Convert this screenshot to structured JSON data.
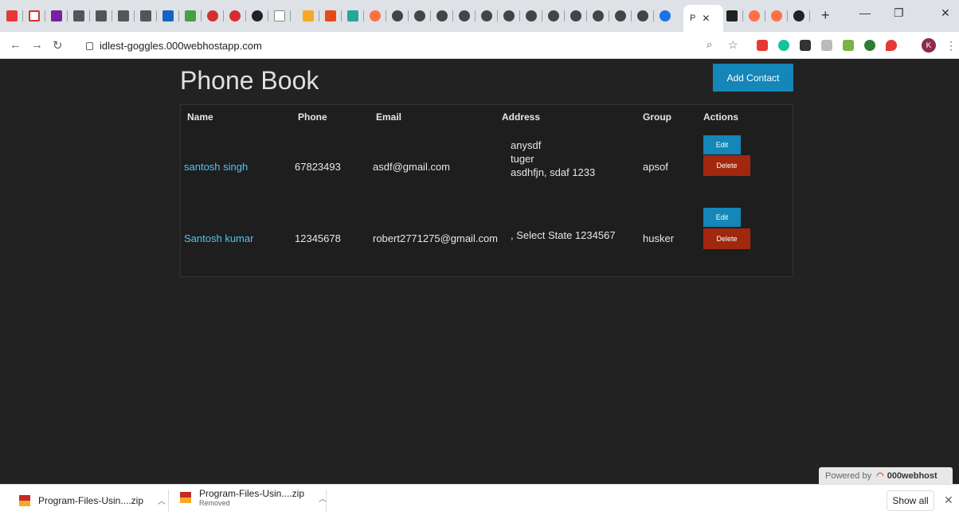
{
  "browser": {
    "active_tab_label": "P",
    "new_tab": "+",
    "url": "idlest-goggles.000webhostapp.com",
    "profile_initial": "K",
    "colors": {
      "tabstrip": "#dee1e6",
      "toolbar": "#ffffff"
    }
  },
  "page": {
    "title": "Phone Book",
    "add_button": "Add Contact",
    "table": {
      "headers": [
        "Name",
        "Phone",
        "Email",
        "Address",
        "Group",
        "Actions"
      ],
      "rows": [
        {
          "name": "santosh singh",
          "phone": "67823493",
          "email": "asdf@gmail.com",
          "address_lines": [
            "anysdf",
            "tuger",
            "asdhfjn, sdaf 1233"
          ],
          "group": "apsof",
          "edit": "Edit",
          "delete": "Delete"
        },
        {
          "name": "Santosh kumar",
          "phone": "12345678",
          "email": "robert2771275@gmail.com",
          "address_lines": [
            ", Select State 1234567"
          ],
          "group": "husker",
          "edit": "Edit",
          "delete": "Delete"
        }
      ]
    },
    "powered_by": {
      "prefix": "Powered by",
      "brand": "000webhost"
    },
    "colors": {
      "background": "#222222",
      "link": "#4fc3f7",
      "primary": "#1486b8",
      "danger": "#a1280f"
    }
  },
  "downloads": {
    "items": [
      {
        "name": "Program-Files-Usin....zip",
        "status": ""
      },
      {
        "name": "Program-Files-Usin....zip",
        "status": "Removed"
      }
    ],
    "show_all": "Show all"
  }
}
